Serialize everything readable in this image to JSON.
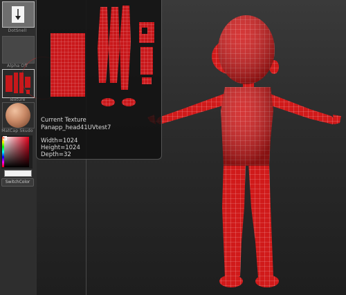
{
  "shelf": {
    "brush_label": "DotSnell",
    "alpha_label": "Alpha Off",
    "texture_label": "Texture",
    "material_label": "MatCap Skudo",
    "switch_color_label": "SwitchColor"
  },
  "texture_popup": {
    "heading": "Current Texture",
    "name": "Panapp_head41UVtest7",
    "width": "Width=1024",
    "height": "Height=1024",
    "depth": "Depth=32"
  },
  "icons": {
    "brush": "down-arrow-icon",
    "texture": "texture-thumbnail-icon",
    "material": "matcap-sphere-icon"
  },
  "colors": {
    "mesh_red": "#d01a1a",
    "wire": "#f2a0a0",
    "background": "#262626"
  }
}
